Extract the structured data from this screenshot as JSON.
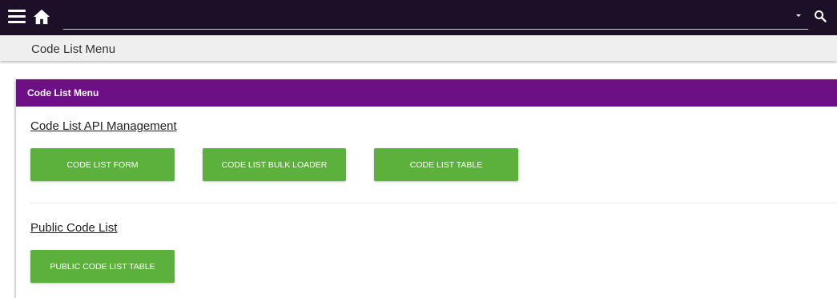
{
  "topbar": {
    "search_value": "",
    "icons": [
      "hamburger-menu-icon",
      "home-icon",
      "dropdown-caret-icon",
      "search-icon"
    ]
  },
  "header": {
    "title": "Code List Menu"
  },
  "card": {
    "title": "Code List Menu",
    "sections": [
      {
        "heading": "Code List API Management",
        "buttons": [
          "CODE LIST FORM",
          "CODE LIST BULK LOADER",
          "CODE LIST TABLE"
        ]
      },
      {
        "heading": "Public Code List",
        "buttons": [
          "PUBLIC CODE LIST TABLE"
        ]
      }
    ]
  },
  "colors": {
    "topbar_bg": "#1b1027",
    "card_header_bg": "#6d0f85",
    "button_bg": "#5cb13c",
    "breadcrumb_bg": "#efefef"
  }
}
